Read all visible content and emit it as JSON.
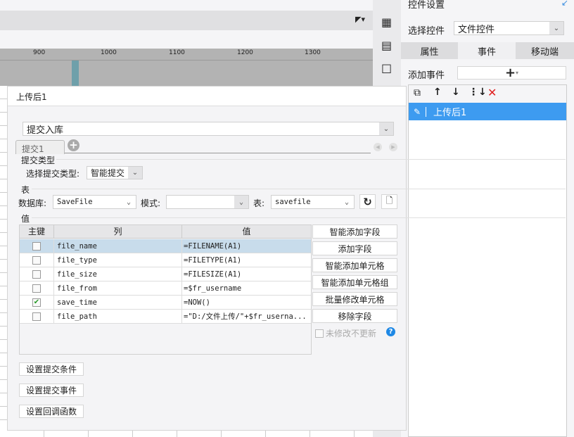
{
  "toolbar": {
    "layout_icon": "layout-dropdown-icon"
  },
  "ruler": {
    "labels": [
      "900",
      "1000",
      "1100",
      "1200",
      "1300"
    ]
  },
  "right_panel": {
    "title": "控件设置",
    "select_widget_label": "选择控件",
    "select_widget_value": "文件控件",
    "tabs": [
      {
        "label": "属性",
        "active": false
      },
      {
        "label": "事件",
        "active": true
      },
      {
        "label": "移动端",
        "active": false
      }
    ],
    "add_event_label": "添加事件",
    "add_event_button": "+",
    "events": [
      {
        "label": "上传后1",
        "selected": true
      }
    ]
  },
  "dialog": {
    "title": "上传后1",
    "action_type": "提交入库",
    "tabs": [
      {
        "label": "提交1"
      }
    ],
    "section_submit_type": "提交类型",
    "submit_type_label": "选择提交类型:",
    "submit_type_value": "智能提交",
    "section_table": "表",
    "database_label": "数据库:",
    "database_value": "SaveFile",
    "schema_label": "模式:",
    "schema_value": "",
    "table_label": "表:",
    "table_value": "savefile",
    "section_value": "值",
    "columns": {
      "key": "主键",
      "column": "列",
      "value": "值"
    },
    "rows": [
      {
        "key": false,
        "column": "file_name",
        "value": "=FILENAME(A1)",
        "selected": true
      },
      {
        "key": false,
        "column": "file_type",
        "value": "=FILETYPE(A1)",
        "selected": false
      },
      {
        "key": false,
        "column": "file_size",
        "value": "=FILESIZE(A1)",
        "selected": false
      },
      {
        "key": false,
        "column": "file_from",
        "value": "=$fr_username",
        "selected": false
      },
      {
        "key": true,
        "column": "save_time",
        "value": "=NOW()",
        "selected": false
      },
      {
        "key": false,
        "column": "file_path",
        "value": "=\"D:/文件上传/\"+$fr_userna...",
        "selected": false
      }
    ],
    "side_buttons": [
      "智能添加字段",
      "添加字段",
      "智能添加单元格",
      "智能添加单元格组",
      "批量修改单元格",
      "移除字段"
    ],
    "no_update_unchanged": "未修改不更新",
    "bottom_buttons": [
      "设置提交条件",
      "设置提交事件",
      "设置回调函数"
    ]
  }
}
